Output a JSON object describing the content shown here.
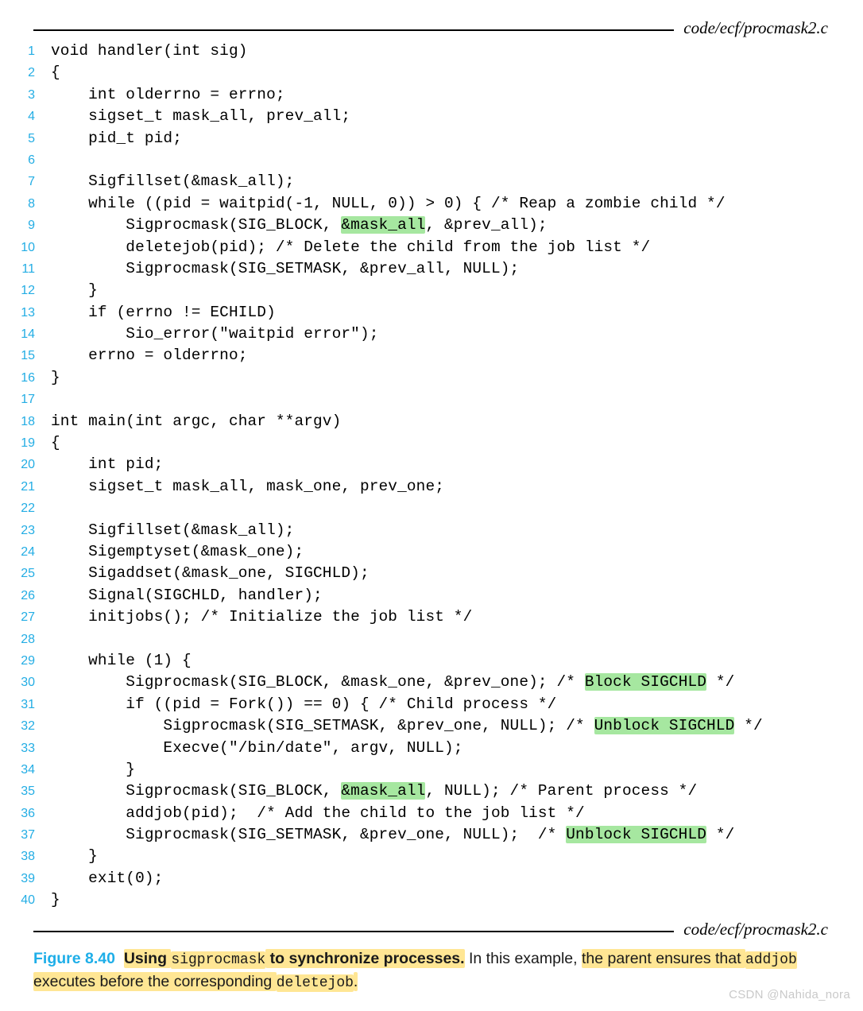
{
  "figure": {
    "file_label_top": "code/ecf/procmask2.c",
    "file_label_bottom": "code/ecf/procmask2.c",
    "line_number_color": "#23ade4",
    "code_highlight_color": "#a6e7a0",
    "caption_highlight_color": "#ffe694",
    "figure_number_color": "#1eaee8"
  },
  "code": {
    "language": "c",
    "first_line_number": 1,
    "lines": [
      {
        "n": "1",
        "segments": [
          {
            "t": "void handler(int sig)"
          }
        ]
      },
      {
        "n": "2",
        "segments": [
          {
            "t": "{"
          }
        ]
      },
      {
        "n": "3",
        "segments": [
          {
            "t": "    int olderrno = errno;"
          }
        ]
      },
      {
        "n": "4",
        "segments": [
          {
            "t": "    sigset_t mask_all, prev_all;"
          }
        ]
      },
      {
        "n": "5",
        "segments": [
          {
            "t": "    pid_t pid;"
          }
        ]
      },
      {
        "n": "6",
        "segments": [
          {
            "t": ""
          }
        ]
      },
      {
        "n": "7",
        "segments": [
          {
            "t": "    Sigfillset(&mask_all);"
          }
        ]
      },
      {
        "n": "8",
        "segments": [
          {
            "t": "    while ((pid = waitpid(-1, NULL, 0)) > 0) { /* Reap a zombie child */"
          }
        ]
      },
      {
        "n": "9",
        "segments": [
          {
            "t": "        Sigprocmask(SIG_BLOCK, "
          },
          {
            "t": "&mask_all",
            "hl": "green"
          },
          {
            "t": ", &prev_all);"
          }
        ]
      },
      {
        "n": "10",
        "segments": [
          {
            "t": "        deletejob(pid); /* Delete the child from the job list */"
          }
        ]
      },
      {
        "n": "11",
        "segments": [
          {
            "t": "        Sigprocmask(SIG_SETMASK, &prev_all, NULL);"
          }
        ]
      },
      {
        "n": "12",
        "segments": [
          {
            "t": "    }"
          }
        ]
      },
      {
        "n": "13",
        "segments": [
          {
            "t": "    if (errno != ECHILD)"
          }
        ]
      },
      {
        "n": "14",
        "segments": [
          {
            "t": "        Sio_error(\"waitpid error\");"
          }
        ]
      },
      {
        "n": "15",
        "segments": [
          {
            "t": "    errno = olderrno;"
          }
        ]
      },
      {
        "n": "16",
        "segments": [
          {
            "t": "}"
          }
        ]
      },
      {
        "n": "17",
        "segments": [
          {
            "t": ""
          }
        ]
      },
      {
        "n": "18",
        "segments": [
          {
            "t": "int main(int argc, char **argv)"
          }
        ]
      },
      {
        "n": "19",
        "segments": [
          {
            "t": "{"
          }
        ]
      },
      {
        "n": "20",
        "segments": [
          {
            "t": "    int pid;"
          }
        ]
      },
      {
        "n": "21",
        "segments": [
          {
            "t": "    sigset_t mask_all, mask_one, prev_one;"
          }
        ]
      },
      {
        "n": "22",
        "segments": [
          {
            "t": ""
          }
        ]
      },
      {
        "n": "23",
        "segments": [
          {
            "t": "    Sigfillset(&mask_all);"
          }
        ]
      },
      {
        "n": "24",
        "segments": [
          {
            "t": "    Sigemptyset(&mask_one);"
          }
        ]
      },
      {
        "n": "25",
        "segments": [
          {
            "t": "    Sigaddset(&mask_one, SIGCHLD);"
          }
        ]
      },
      {
        "n": "26",
        "segments": [
          {
            "t": "    Signal(SIGCHLD, handler);"
          }
        ]
      },
      {
        "n": "27",
        "segments": [
          {
            "t": "    initjobs(); /* Initialize the job list */"
          }
        ]
      },
      {
        "n": "28",
        "segments": [
          {
            "t": ""
          }
        ]
      },
      {
        "n": "29",
        "segments": [
          {
            "t": "    while (1) {"
          }
        ]
      },
      {
        "n": "30",
        "segments": [
          {
            "t": "        Sigprocmask(SIG_BLOCK, &mask_one, &prev_one); /* "
          },
          {
            "t": "Block SIGCHLD",
            "hl": "green"
          },
          {
            "t": " */"
          }
        ]
      },
      {
        "n": "31",
        "segments": [
          {
            "t": "        if ((pid = Fork()) == 0) { /* Child process */"
          }
        ]
      },
      {
        "n": "32",
        "segments": [
          {
            "t": "            Sigprocmask(SIG_SETMASK, &prev_one, NULL); /* "
          },
          {
            "t": "Unblock SIGCHLD",
            "hl": "green"
          },
          {
            "t": " */"
          }
        ]
      },
      {
        "n": "33",
        "segments": [
          {
            "t": "            Execve(\"/bin/date\", argv, NULL);"
          }
        ]
      },
      {
        "n": "34",
        "segments": [
          {
            "t": "        }"
          }
        ]
      },
      {
        "n": "35",
        "segments": [
          {
            "t": "        Sigprocmask(SIG_BLOCK, "
          },
          {
            "t": "&mask_all",
            "hl": "green"
          },
          {
            "t": ", NULL); /* Parent process */"
          }
        ]
      },
      {
        "n": "36",
        "segments": [
          {
            "t": "        addjob(pid);  /* Add the child to the job list */"
          }
        ]
      },
      {
        "n": "37",
        "segments": [
          {
            "t": "        Sigprocmask(SIG_SETMASK, &prev_one, NULL);  /* "
          },
          {
            "t": "Unblock SIGCHLD",
            "hl": "green"
          },
          {
            "t": " */"
          }
        ]
      },
      {
        "n": "38",
        "segments": [
          {
            "t": "    }"
          }
        ]
      },
      {
        "n": "39",
        "segments": [
          {
            "t": "    exit(0);"
          }
        ]
      },
      {
        "n": "40",
        "segments": [
          {
            "t": "}"
          }
        ]
      }
    ]
  },
  "caption": {
    "figure_number": "Figure 8.40",
    "segments": [
      {
        "t": "Using ",
        "bold": true,
        "hl": "yellow"
      },
      {
        "t": "sigprocmask",
        "mono": true,
        "hl": "yellow"
      },
      {
        "t": " to synchronize processes.",
        "bold": true,
        "hl": "yellow"
      },
      {
        "t": " In this example, "
      },
      {
        "t": "the parent ensures that ",
        "hl": "yellow"
      },
      {
        "t": "addjob",
        "mono": true,
        "hl": "yellow"
      },
      {
        "t": " executes before the corresponding ",
        "hl": "yellow"
      },
      {
        "t": "deletejob",
        "mono": true,
        "hl": "yellow"
      },
      {
        "t": ".",
        "hl": "yellow"
      }
    ],
    "plain_text": "Figure 8.40  Using sigprocmask to synchronize processes. In this example, the parent ensures that addjob executes before the corresponding deletejob."
  },
  "watermark": {
    "text": "CSDN @Nahida_nora"
  }
}
